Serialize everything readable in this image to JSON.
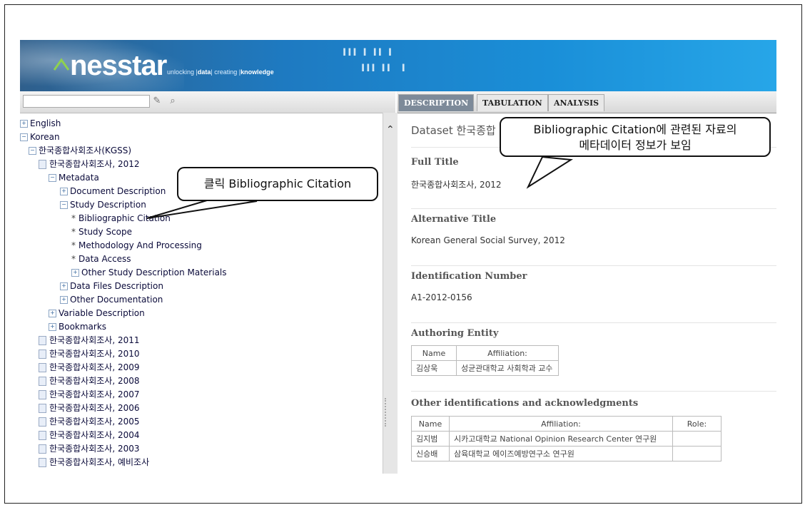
{
  "banner": {
    "logo": "nesstar",
    "tagline_prefix": "unlocking",
    "tagline_data": "data",
    "tagline_mid": "creating",
    "tagline_knowledge": "knowledge"
  },
  "search": {
    "value": ""
  },
  "tabs": [
    {
      "label": "DESCRIPTION",
      "active": true
    },
    {
      "label": "TABULATION",
      "active": false
    },
    {
      "label": "ANALYSIS",
      "active": false
    }
  ],
  "tree": [
    {
      "label": "English",
      "icon": "expand"
    },
    {
      "label": "Korean",
      "icon": "collapse"
    },
    {
      "label": "한국종합사회조사(KGSS)",
      "icon": "collapse"
    },
    {
      "label": "한국종합사회조사, 2012",
      "icon": "document"
    },
    {
      "label": "Metadata",
      "icon": "collapse"
    },
    {
      "label": "Document Description",
      "icon": "expand"
    },
    {
      "label": "Study Description",
      "icon": "collapse"
    },
    {
      "label": "Bibliographic Citation",
      "icon": "bullet"
    },
    {
      "label": "Study Scope",
      "icon": "bullet"
    },
    {
      "label": "Methodology And Processing",
      "icon": "bullet"
    },
    {
      "label": "Data Access",
      "icon": "bullet"
    },
    {
      "label": "Other Study Description Materials",
      "icon": "expand"
    },
    {
      "label": "Data Files Description",
      "icon": "expand"
    },
    {
      "label": "Other Documentation",
      "icon": "expand"
    },
    {
      "label": "Variable Description",
      "icon": "expand"
    },
    {
      "label": "Bookmarks",
      "icon": "expand"
    },
    {
      "label": "한국종합사회조사, 2011",
      "icon": "document"
    },
    {
      "label": "한국종합사회조사, 2010",
      "icon": "document"
    },
    {
      "label": "한국종합사회조사, 2009",
      "icon": "document"
    },
    {
      "label": "한국종합사회조사, 2008",
      "icon": "document"
    },
    {
      "label": "한국종합사회조사, 2007",
      "icon": "document"
    },
    {
      "label": "한국종합사회조사, 2006",
      "icon": "document"
    },
    {
      "label": "한국종합사회조사, 2005",
      "icon": "document"
    },
    {
      "label": "한국종합사회조사, 2004",
      "icon": "document"
    },
    {
      "label": "한국종합사회조사, 2003",
      "icon": "document"
    },
    {
      "label": "한국종합사회조사, 예비조사",
      "icon": "document"
    }
  ],
  "content": {
    "dataset_title": "Dataset 한국종합",
    "full_title_label": "Full Title",
    "full_title_value": "한국종합사회조사, 2012",
    "alt_title_label": "Alternative Title",
    "alt_title_value": "Korean General Social Survey, 2012",
    "id_label": "Identification Number",
    "id_value": "A1-2012-0156",
    "authoring_label": "Authoring Entity",
    "authoring_headers": [
      "Name",
      "Affiliation:"
    ],
    "authoring_rows": [
      [
        "김상욱",
        "성균관대학교 사회학과 교수"
      ]
    ],
    "other_label": "Other identifications and acknowledgments",
    "other_headers": [
      "Name",
      "Affiliation:",
      "Role:"
    ],
    "other_rows": [
      [
        "김지범",
        "시카고대학교 National Opinion Research Center 연구원",
        ""
      ],
      [
        "신승배",
        "삼육대학교 에이즈예방연구소 연구원",
        ""
      ]
    ]
  },
  "callouts": {
    "click_note": "클릭 Bibliographic Citation",
    "info_note_line1": "Bibliographic Citation에  관련된 자료의",
    "info_note_line2": "메타데이터 정보가 보임"
  }
}
